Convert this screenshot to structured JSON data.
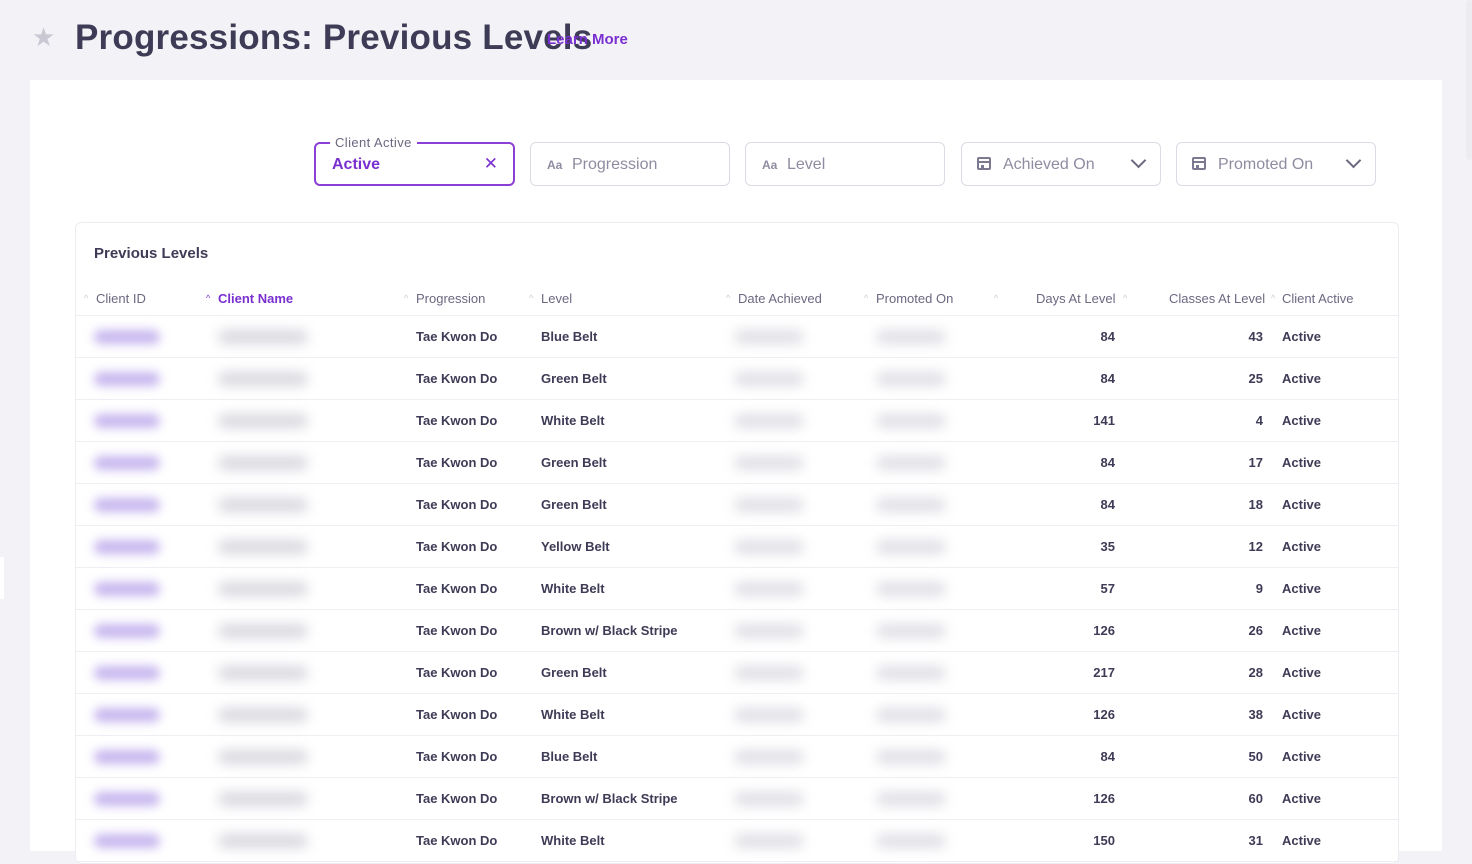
{
  "header": {
    "title": "Progressions: Previous Levels",
    "learn_more": "Learn More"
  },
  "filters": {
    "client_active": {
      "label": "Client Active",
      "value": "Active"
    },
    "progression": {
      "placeholder": "Progression",
      "type_glyph": "Aa"
    },
    "level": {
      "placeholder": "Level",
      "type_glyph": "Aa"
    },
    "achieved_on": {
      "placeholder": "Achieved On"
    },
    "promoted_on": {
      "placeholder": "Promoted On"
    }
  },
  "table": {
    "title": "Previous Levels",
    "sorted_column": "Client Name",
    "columns": [
      "Client ID",
      "Client Name",
      "Progression",
      "Level",
      "Date Achieved",
      "Promoted On",
      "Days At Level",
      "Classes At Level",
      "Client Active"
    ],
    "rows": [
      {
        "progression": "Tae Kwon Do",
        "level": "Blue Belt",
        "days": "84",
        "classes": "43",
        "active": "Active"
      },
      {
        "progression": "Tae Kwon Do",
        "level": "Green Belt",
        "days": "84",
        "classes": "25",
        "active": "Active"
      },
      {
        "progression": "Tae Kwon Do",
        "level": "White Belt",
        "days": "141",
        "classes": "4",
        "active": "Active"
      },
      {
        "progression": "Tae Kwon Do",
        "level": "Green Belt",
        "days": "84",
        "classes": "17",
        "active": "Active"
      },
      {
        "progression": "Tae Kwon Do",
        "level": "Green Belt",
        "days": "84",
        "classes": "18",
        "active": "Active"
      },
      {
        "progression": "Tae Kwon Do",
        "level": "Yellow Belt",
        "days": "35",
        "classes": "12",
        "active": "Active"
      },
      {
        "progression": "Tae Kwon Do",
        "level": "White Belt",
        "days": "57",
        "classes": "9",
        "active": "Active"
      },
      {
        "progression": "Tae Kwon Do",
        "level": "Brown w/ Black Stripe",
        "days": "126",
        "classes": "26",
        "active": "Active"
      },
      {
        "progression": "Tae Kwon Do",
        "level": "Green Belt",
        "days": "217",
        "classes": "28",
        "active": "Active"
      },
      {
        "progression": "Tae Kwon Do",
        "level": "White Belt",
        "days": "126",
        "classes": "38",
        "active": "Active"
      },
      {
        "progression": "Tae Kwon Do",
        "level": "Blue Belt",
        "days": "84",
        "classes": "50",
        "active": "Active"
      },
      {
        "progression": "Tae Kwon Do",
        "level": "Brown w/ Black Stripe",
        "days": "126",
        "classes": "60",
        "active": "Active"
      },
      {
        "progression": "Tae Kwon Do",
        "level": "White Belt",
        "days": "150",
        "classes": "31",
        "active": "Active"
      }
    ]
  },
  "colors": {
    "accent": "#7a2fd0",
    "background": "#f3f3f7",
    "text": "#3e3b56"
  }
}
